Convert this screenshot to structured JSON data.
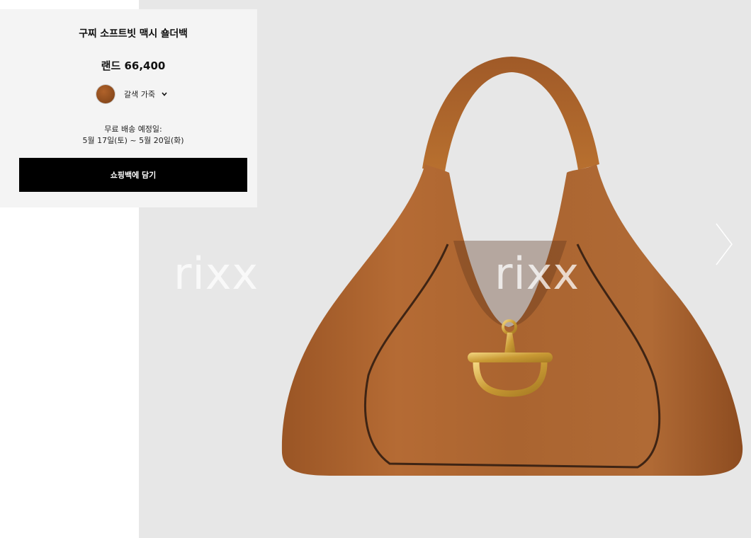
{
  "product": {
    "title": "구찌 소프트빗 맥시 숄더백",
    "price": "랜드 66,400",
    "color_option": "갈색 가죽",
    "color_swatch": "#8a4a1c"
  },
  "delivery": {
    "label": "무료 배송 예정일:",
    "dates": "5월 17일(토) ~ 5월 20일(화)"
  },
  "actions": {
    "add_to_bag": "쇼핑백에 담기"
  },
  "gallery": {
    "watermark": "rixx",
    "image_name": "brown-leather-shoulder-bag",
    "background": "#e7e7e7",
    "next_icon": "chevron-right-icon"
  }
}
